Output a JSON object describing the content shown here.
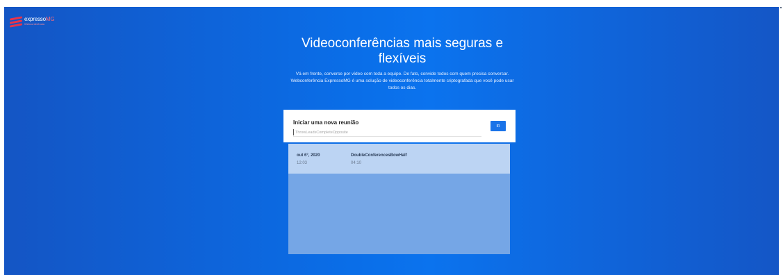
{
  "logo": {
    "name_main": "expresso",
    "name_accent": "MG",
    "subtitle": "Webconferência",
    "brand_color": "#e8344a"
  },
  "hero": {
    "title": "Videoconferências mais seguras e flexíveis",
    "description": "Vá em frente, converse por vídeo com toda a equipe. De fato, convide todos com quem precisa conversar. Webconferência ExpressoMG é uma solução de videoconferência totalmente criptografada que você pode usar todos os dias."
  },
  "new_meeting": {
    "title": "Iniciar uma nova reunião",
    "input_value": "",
    "input_placeholder": "ThrowLeadsCompleteOpposite",
    "button_label": "IR"
  },
  "recent": [
    {
      "date": "out 6°, 2020",
      "time": "12:03",
      "name": "DoubleConferencesBowHalf",
      "duration": "04:10"
    }
  ],
  "colors": {
    "background": "#0b6fea",
    "accent": "#1a73e8",
    "panel": "#75a6e6",
    "row": "#bcd4f3"
  }
}
